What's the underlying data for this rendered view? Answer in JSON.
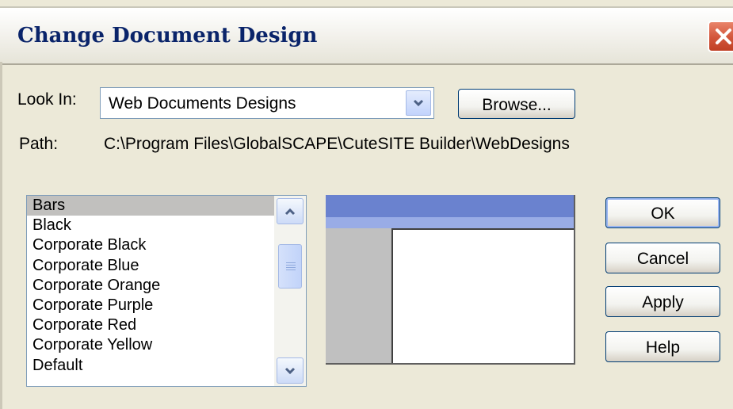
{
  "window": {
    "title": "Change Document Design"
  },
  "look_in": {
    "label": "Look In:",
    "selected_value": "Web Documents Designs",
    "browse_label": "Browse..."
  },
  "path": {
    "label": "Path:",
    "value": "C:\\Program Files\\GlobalSCAPE\\CuteSITE Builder\\WebDesigns"
  },
  "designs_list": {
    "items": [
      "Bars",
      "Black",
      "Corporate Black",
      "Corporate Blue",
      "Corporate Orange",
      "Corporate Purple",
      "Corporate Red",
      "Corporate Yellow",
      "Default"
    ],
    "selected_index": 0
  },
  "buttons": {
    "ok": "OK",
    "cancel": "Cancel",
    "apply": "Apply",
    "help": "Help"
  },
  "icons": {
    "close": "close-icon",
    "dropdown": "chevron-down-icon",
    "scroll_up": "chevron-up-icon",
    "scroll_down": "chevron-down-icon"
  },
  "colors": {
    "title_text": "#0a246a",
    "close_button": "#d2553a",
    "preview_header": "#6a82cf",
    "preview_band": "#99ace6",
    "selection": "#c1c0be"
  }
}
